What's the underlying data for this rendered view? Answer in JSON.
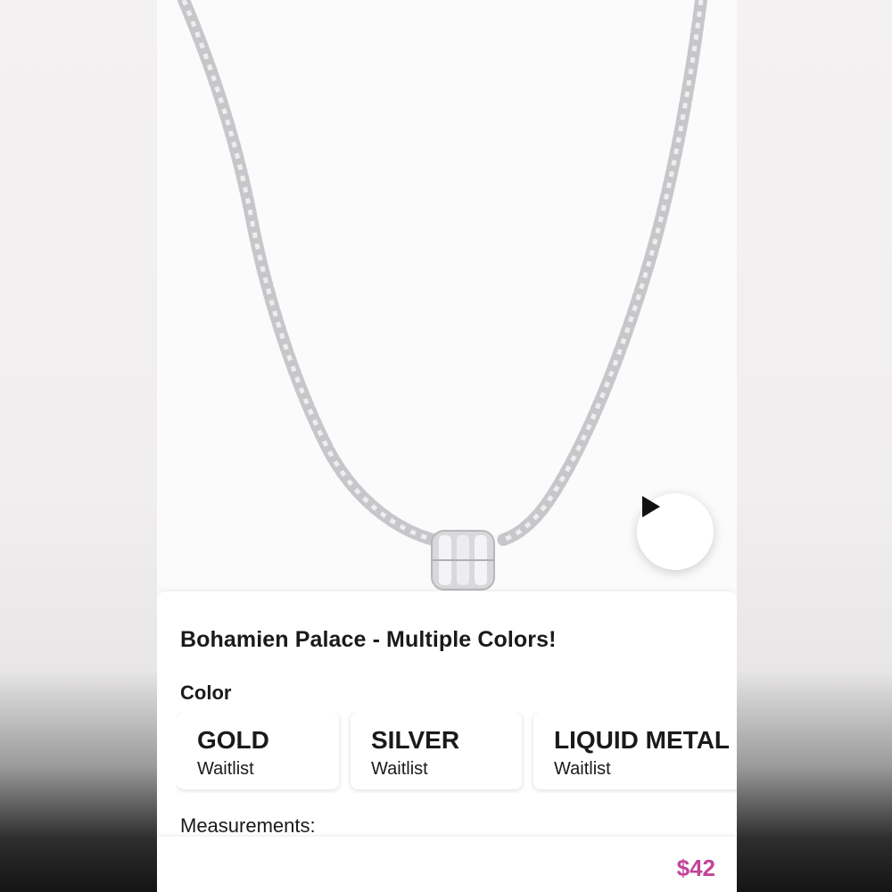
{
  "product": {
    "title": "Bohamien Palace - Multiple Colors!",
    "color_label": "Color",
    "options": [
      {
        "name": "GOLD",
        "status": "Waitlist"
      },
      {
        "name": "SILVER",
        "status": "Waitlist"
      },
      {
        "name": "LIQUID METAL",
        "status": "Waitlist"
      }
    ],
    "measurements_label": "Measurements:",
    "price": "$42"
  },
  "icons": {
    "play": "play-icon",
    "image": "necklace-image"
  },
  "colors": {
    "price_accent": "#c2449a",
    "chain": "#c9c9cc"
  }
}
